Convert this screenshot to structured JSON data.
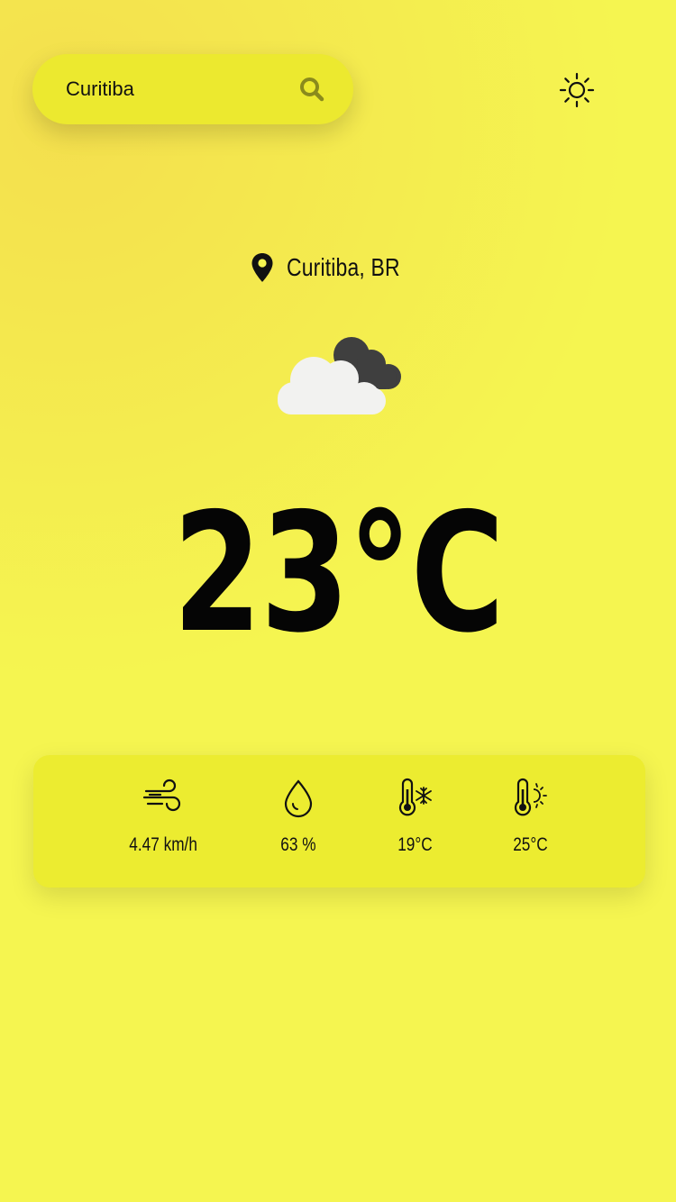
{
  "search": {
    "value": "Curitiba",
    "icon": "search-icon"
  },
  "theme_toggle": {
    "icon": "sun-icon"
  },
  "location": {
    "icon": "map-pin-icon",
    "label": "Curitiba, BR"
  },
  "weather": {
    "condition_icon": "cloudy-icon",
    "temperature": "23°C"
  },
  "stats": [
    {
      "icon": "wind-icon",
      "value": "4.47 km/h"
    },
    {
      "icon": "humidity-drop-icon",
      "value": "63 %"
    },
    {
      "icon": "thermometer-cold-icon",
      "value": "19°C"
    },
    {
      "icon": "thermometer-hot-icon",
      "value": "25°C"
    }
  ],
  "colors": {
    "background": "#f5f550",
    "card": "#ecec30",
    "text": "#111111",
    "search_icon": "#8a8a1c"
  }
}
